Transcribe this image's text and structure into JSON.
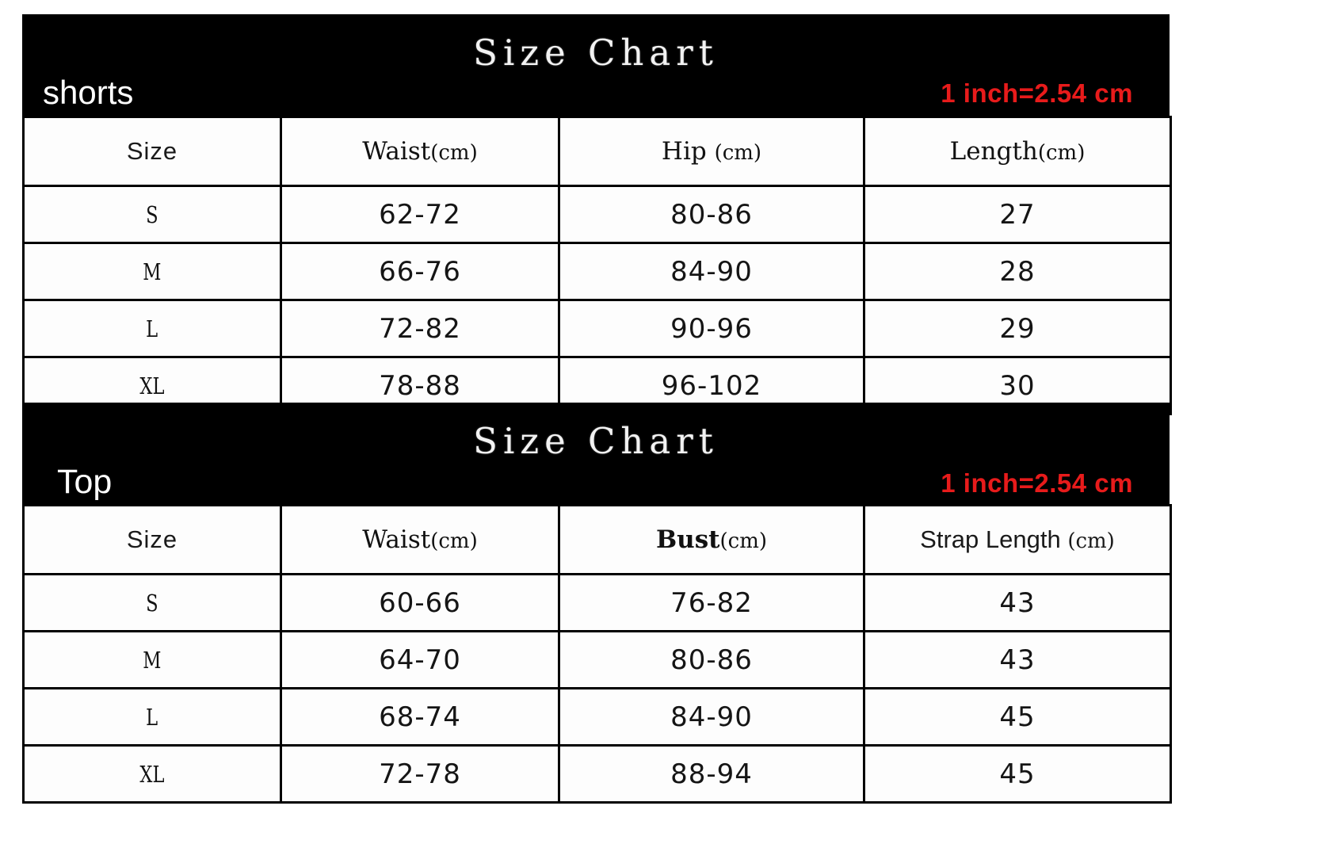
{
  "charts": [
    {
      "id": "shorts",
      "title": "Size Chart",
      "category": "shorts",
      "note": "1 inch=2.54 cm",
      "note_color": "#e81b1b",
      "headers": [
        {
          "text": "Size",
          "style": "sans"
        },
        {
          "text": "Waist",
          "unit": "(cm)",
          "style": "serif"
        },
        {
          "text": "Hip ",
          "unit": "(cm)",
          "style": "serif"
        },
        {
          "text": "Length",
          "unit": "(cm)",
          "style": "serif"
        }
      ],
      "rows": [
        {
          "size": "S",
          "c2": "62-72",
          "c3": "80-86",
          "c4": "27"
        },
        {
          "size": "M",
          "c2": "66-76",
          "c3": "84-90",
          "c4": "28"
        },
        {
          "size": "L",
          "c2": "72-82",
          "c3": "90-96",
          "c4": "29"
        },
        {
          "size": "XL",
          "c2": "78-88",
          "c3": "96-102",
          "c4": "30"
        }
      ]
    },
    {
      "id": "top",
      "title": "Size Chart",
      "category": "Top",
      "note": "1 inch=2.54 cm",
      "note_color": "#e81b1b",
      "headers": [
        {
          "text": "Size",
          "style": "sans"
        },
        {
          "text": "Waist",
          "unit": "(cm)",
          "style": "serif"
        },
        {
          "text": "Bust",
          "unit": "(cm)",
          "style": "serif-bold"
        },
        {
          "text": "Strap Length ",
          "unit": "(cm)",
          "style": "mixed"
        }
      ],
      "rows": [
        {
          "size": "S",
          "c2": "60-66",
          "c3": "76-82",
          "c4": "43"
        },
        {
          "size": "M",
          "c2": "64-70",
          "c3": "80-86",
          "c4": "43"
        },
        {
          "size": "L",
          "c2": "68-74",
          "c3": "84-90",
          "c4": "45"
        },
        {
          "size": "XL",
          "c2": "72-78",
          "c3": "88-94",
          "c4": "45"
        }
      ]
    }
  ]
}
